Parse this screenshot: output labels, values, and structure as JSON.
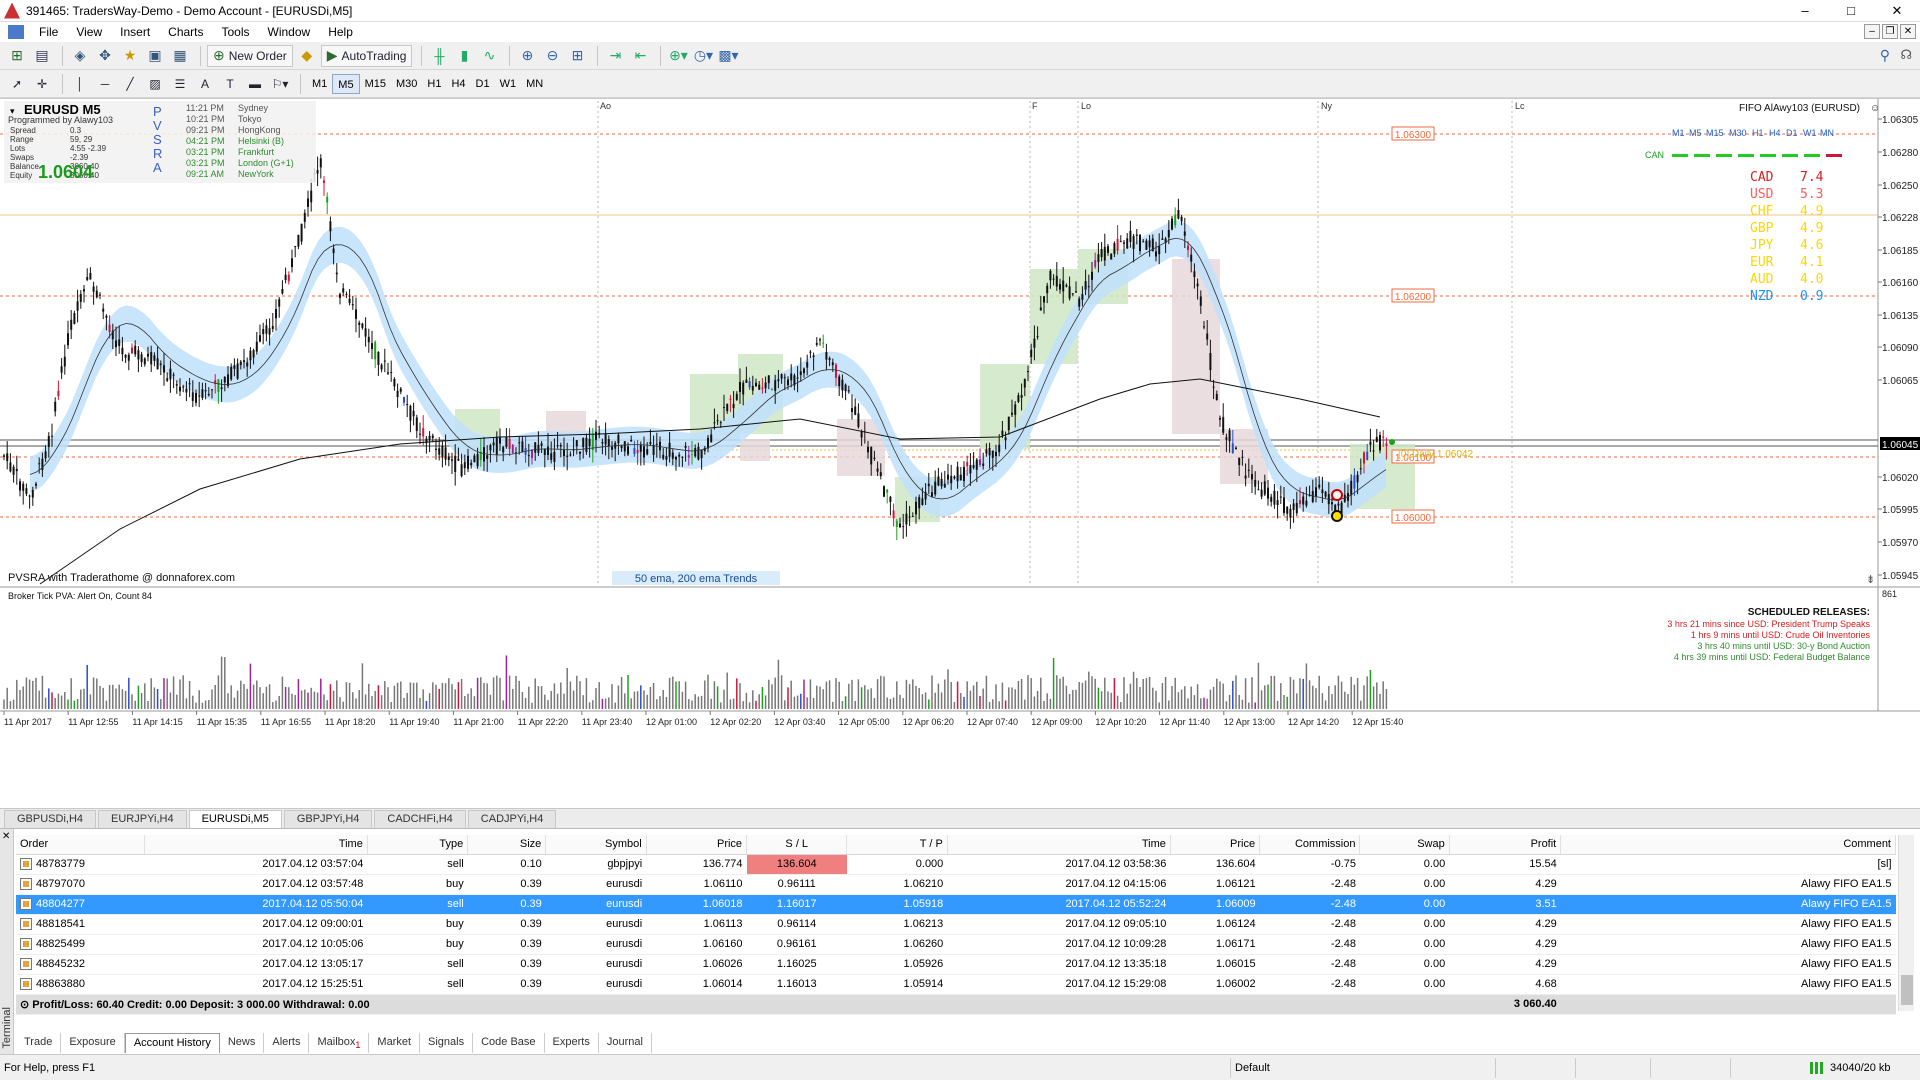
{
  "window": {
    "title": "391465: TradersWay-Demo - Demo Account - [EURUSDi,M5]",
    "controls": [
      "–",
      "□",
      "✕"
    ]
  },
  "menu": [
    "File",
    "View",
    "Insert",
    "Charts",
    "Tools",
    "Window",
    "Help"
  ],
  "mdi_controls": [
    "–",
    "❐",
    "✕"
  ],
  "toolbar": {
    "new_order": "New Order",
    "autotrading": "AutoTrading"
  },
  "timeframes": [
    "M1",
    "M5",
    "M15",
    "M30",
    "H1",
    "H4",
    "D1",
    "W1",
    "MN"
  ],
  "active_timeframe": "M5",
  "chart": {
    "symbol": "EURUSD  M5",
    "programmed_by": "Programmed by Alawy103",
    "left_stats": [
      {
        "label": "Spread",
        "value": "0.3"
      },
      {
        "label": "Range",
        "value": "59, 29"
      },
      {
        "label": "Lots",
        "value": "4.55 -2.39"
      },
      {
        "label": "Swaps",
        "value": "-2.39"
      },
      {
        "label": "Balance",
        "value": "3060.40"
      },
      {
        "label": "Equity",
        "value": "3060.40"
      }
    ],
    "big_price": "1.0604",
    "pvsra_letters": [
      "P",
      "V",
      "S",
      "R",
      "A"
    ],
    "sessions": [
      {
        "time": "11:21 PM",
        "city": "Sydney",
        "color": "#555555"
      },
      {
        "time": "10:21 PM",
        "city": "Tokyo",
        "color": "#555555"
      },
      {
        "time": "09:21 PM",
        "city": "HongKong",
        "color": "#555555"
      },
      {
        "time": "04:21 PM",
        "city": "Helsinki (B)",
        "color": "#2e8b2e"
      },
      {
        "time": "03:21 PM",
        "city": "Frankfurt",
        "color": "#2e8b2e"
      },
      {
        "time": "03:21 PM",
        "city": "London (G+1)",
        "color": "#2e8b2e"
      },
      {
        "time": "09:21 AM",
        "city": "NewYork",
        "color": "#2e8b2e"
      }
    ],
    "session_markers": [
      "Ao",
      "F",
      "Lo",
      "Ny",
      "Lc"
    ],
    "ea_label": "FIFO AlAwy103 (EURUSD)",
    "mtf_labels": [
      "M1",
      "M5",
      "M15",
      "M30",
      "H1",
      "H4",
      "D1",
      "W1",
      "MN"
    ],
    "can_label": "CAN",
    "currency_strength": [
      {
        "ccy": "CAD",
        "val": "7.4",
        "color": "#d42020"
      },
      {
        "ccy": "USD",
        "val": "5.3",
        "color": "#ff5a5a"
      },
      {
        "ccy": "CHF",
        "val": "4.9",
        "color": "#ffd700"
      },
      {
        "ccy": "GBP",
        "val": "4.9",
        "color": "#ffd700"
      },
      {
        "ccy": "JPY",
        "val": "4.6",
        "color": "#ffd700"
      },
      {
        "ccy": "EUR",
        "val": "4.1",
        "color": "#ffd700"
      },
      {
        "ccy": "AUD",
        "val": "4.0",
        "color": "#ffd700"
      },
      {
        "ccy": "NZD",
        "val": "0.9",
        "color": "#1e90ff"
      }
    ],
    "price_levels": [
      "1.06300",
      "1.06200",
      "1.06100",
      "1.06000"
    ],
    "current_price": "1.06045",
    "daily_label": "[0] Daily 1.06042",
    "axis_prices": [
      "1.06305",
      "1.06280",
      "1.06250",
      "1.06228",
      "1.06185",
      "1.06160",
      "1.06135",
      "1.06090",
      "1.06065",
      "1.06045",
      "1.06020",
      "1.05995",
      "1.05970",
      "1.05945"
    ],
    "footer_left": "PVSRA with Traderathome @ donnaforex.com",
    "footer_center": "50 ema, 200 ema Trends",
    "x_axis": [
      "11 Apr 2017",
      "11 Apr 12:55",
      "11 Apr 14:15",
      "11 Apr 15:35",
      "11 Apr 16:55",
      "11 Apr 18:20",
      "11 Apr 19:40",
      "11 Apr 21:00",
      "11 Apr 22:20",
      "11 Apr 23:40",
      "12 Apr 01:00",
      "12 Apr 02:20",
      "12 Apr 03:40",
      "12 Apr 05:00",
      "12 Apr 06:20",
      "12 Apr 07:40",
      "12 Apr 09:00",
      "12 Apr 10:20",
      "12 Apr 11:40",
      "12 Apr 13:00",
      "12 Apr 14:20",
      "12 Apr 15:40"
    ],
    "sub_label": "Broker Tick PVA:    Alert On,  Count  84",
    "sub_axis_value": "861",
    "releases_title": "SCHEDULED RELEASES:",
    "releases": [
      {
        "text": "3 hrs 21 mins since USD: President Trump Speaks",
        "color": "#d42020"
      },
      {
        "text": "1 hrs 9 mins until USD: Crude Oil Inventories",
        "color": "#d42020"
      },
      {
        "text": "3 hrs 40 mins until USD: 30-y Bond Auction",
        "color": "#2e8b2e"
      },
      {
        "text": "4 hrs 39 mins until USD: Federal Budget Balance",
        "color": "#2e8b2e"
      }
    ]
  },
  "chart_tabs": [
    "GBPUSDi,H4",
    "EURJPYi,H4",
    "EURUSDi,M5",
    "GBPJPYi,H4",
    "CADCHFi,H4",
    "CADJPYi,H4"
  ],
  "active_chart_tab": "EURUSDi,M5",
  "terminal": {
    "side_label": "Terminal",
    "columns": [
      "Order",
      "Time",
      "Type",
      "Size",
      "Symbol",
      "Price",
      "S / L",
      "T / P",
      "Time",
      "Price",
      "Commission",
      "Swap",
      "Profit",
      "Comment"
    ],
    "rows": [
      [
        "48783779",
        "2017.04.12 03:57:04",
        "sell",
        "0.10",
        "gbpjpyi",
        "136.774",
        "136.604",
        "0.000",
        "2017.04.12 03:58:36",
        "136.604",
        "-0.75",
        "0.00",
        "15.54",
        "[sl]"
      ],
      [
        "48797070",
        "2017.04.12 03:57:48",
        "buy",
        "0.39",
        "eurusdi",
        "1.06110",
        "0.96111",
        "1.06210",
        "2017.04.12 04:15:06",
        "1.06121",
        "-2.48",
        "0.00",
        "4.29",
        "Alawy FIFO EA1.5"
      ],
      [
        "48804277",
        "2017.04.12 05:50:04",
        "sell",
        "0.39",
        "eurusdi",
        "1.06018",
        "1.16017",
        "1.05918",
        "2017.04.12 05:52:24",
        "1.06009",
        "-2.48",
        "0.00",
        "3.51",
        "Alawy FIFO EA1.5"
      ],
      [
        "48818541",
        "2017.04.12 09:00:01",
        "buy",
        "0.39",
        "eurusdi",
        "1.06113",
        "0.96114",
        "1.06213",
        "2017.04.12 09:05:10",
        "1.06124",
        "-2.48",
        "0.00",
        "4.29",
        "Alawy FIFO EA1.5"
      ],
      [
        "48825499",
        "2017.04.12 10:05:06",
        "buy",
        "0.39",
        "eurusdi",
        "1.06160",
        "0.96161",
        "1.06260",
        "2017.04.12 10:09:28",
        "1.06171",
        "-2.48",
        "0.00",
        "4.29",
        "Alawy FIFO EA1.5"
      ],
      [
        "48845232",
        "2017.04.12 13:05:17",
        "sell",
        "0.39",
        "eurusdi",
        "1.06026",
        "1.16025",
        "1.05926",
        "2017.04.12 13:35:18",
        "1.06015",
        "-2.48",
        "0.00",
        "4.29",
        "Alawy FIFO EA1.5"
      ],
      [
        "48863880",
        "2017.04.12 15:25:51",
        "sell",
        "0.39",
        "eurusdi",
        "1.06014",
        "1.16013",
        "1.05914",
        "2017.04.12 15:29:08",
        "1.06002",
        "-2.48",
        "0.00",
        "4.68",
        "Alawy FIFO EA1.5"
      ]
    ],
    "selected_row": 2,
    "summary": "Profit/Loss: 60.40  Credit: 0.00  Deposit: 3 000.00  Withdrawal: 0.00",
    "summary_total": "3 060.40",
    "tabs": [
      "Trade",
      "Exposure",
      "Account History",
      "News",
      "Alerts",
      "Mailbox",
      "Market",
      "Signals",
      "Code Base",
      "Experts",
      "Journal"
    ],
    "mailbox_badge": "1",
    "active_tab": "Account History"
  },
  "status": {
    "help": "For Help, press F1",
    "profile": "Default",
    "traffic": "34040/20 kb"
  }
}
